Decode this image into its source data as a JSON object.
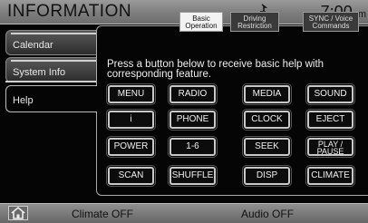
{
  "header": {
    "title": "INFORMATION",
    "clock": "7:00",
    "clock_suffix": "am"
  },
  "sidebar": {
    "items": [
      {
        "label": "Calendar"
      },
      {
        "label": "System Info"
      },
      {
        "label": "Help",
        "selected": true
      }
    ]
  },
  "subtabs": [
    {
      "label": "Basic Operation",
      "selected": true
    },
    {
      "label": "Driving Restriction"
    },
    {
      "label": "SYNC / Voice Commands"
    }
  ],
  "instructions": "Press a button below to receive basic help with corresponding feature.",
  "help_buttons": [
    "MENU",
    "RADIO",
    "MEDIA",
    "SOUND",
    "i",
    "PHONE",
    "CLOCK",
    "EJECT",
    "POWER",
    "1-6",
    "SEEK",
    "PLAY / PAUSE",
    "SCAN",
    "SHUFFLE",
    "DISP",
    "CLIMATE"
  ],
  "footer": {
    "climate_status": "Climate OFF",
    "audio_status": "Audio OFF"
  },
  "icons": {
    "home": "home-icon",
    "signal": "signal-icon"
  }
}
